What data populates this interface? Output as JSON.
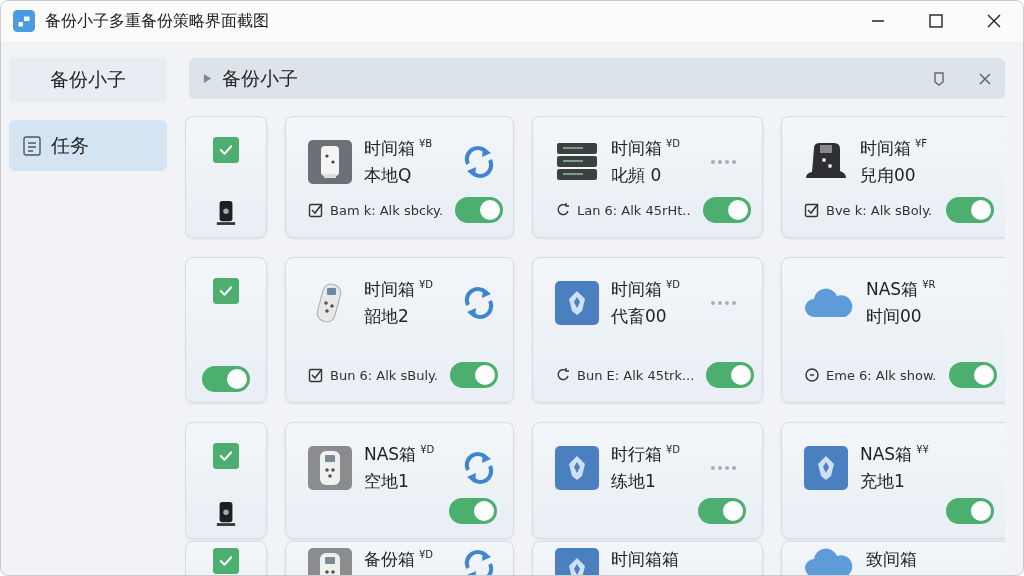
{
  "window": {
    "title": "备份小子多重备份策略界面截图"
  },
  "sidebar": {
    "items": [
      {
        "label": "备份小子",
        "selected": false
      },
      {
        "label": "任务",
        "selected": true
      }
    ]
  },
  "breadcrumb": {
    "text": "备份小子"
  },
  "rows": [
    {
      "selector": {
        "checked": true
      },
      "tasks": [
        {
          "title": "时间箱",
          "tag": "¥B",
          "subtitle": "本地Q",
          "status": "Bam k: Alk sbcky.",
          "on": true
        },
        {
          "title": "时间箱",
          "tag": "¥D",
          "subtitle": "叱頻 0",
          "status": "Lan 6: Alk 45rHt..",
          "on": true
        },
        {
          "title": "时间箱",
          "tag": "¥F",
          "subtitle": "兒甪00",
          "status": "Bve k: Alk sBoly.",
          "on": true
        }
      ]
    },
    {
      "selector": {
        "checked": true,
        "on": true
      },
      "tasks": [
        {
          "title": "时间箱",
          "tag": "¥D",
          "subtitle": "韶地2",
          "status": "Bun 6: Alk sBuly.",
          "on": true
        },
        {
          "title": "时间箱",
          "tag": "¥D",
          "subtitle": "代畜00",
          "status": "Bun E: Alk 45trk...",
          "on": true
        },
        {
          "title": "NAS箱",
          "tag": "¥R",
          "subtitle": "时间00",
          "status": "Eme 6: Alk show.",
          "on": true
        }
      ]
    },
    {
      "selector": {
        "checked": true
      },
      "tasks": [
        {
          "title": "NAS箱",
          "tag": "¥D",
          "subtitle": "空地1",
          "on": true
        },
        {
          "title": "时行箱",
          "tag": "¥D",
          "subtitle": "练地1",
          "on": true
        },
        {
          "title": "NAS箱",
          "tag": "¥¥",
          "subtitle": "充地1",
          "on": true
        }
      ]
    },
    {
      "selector": {
        "checked": true
      },
      "tasks": [
        {
          "title": "备份箱",
          "tag": "¥D"
        },
        {
          "title": "时间箱箱"
        },
        {
          "title": "致间箱"
        }
      ]
    }
  ]
}
